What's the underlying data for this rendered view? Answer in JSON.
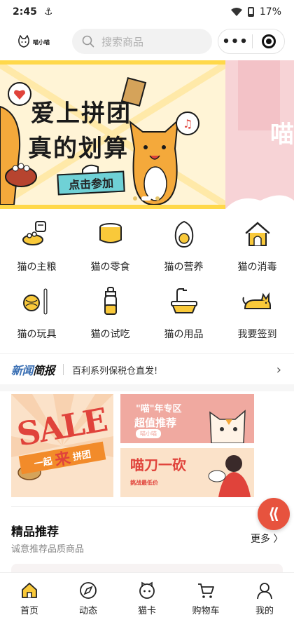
{
  "status_bar": {
    "time": "2:45",
    "battery": "17%"
  },
  "header": {
    "logo_text": "喵小喵",
    "search_placeholder": "搜索商品",
    "more_label": "•••"
  },
  "banner": {
    "slide1_line1": "爱上拼团",
    "slide1_line2": "真的划算",
    "slide1_cta": "点击参加",
    "slide2_partial": "喵"
  },
  "categories": [
    {
      "label": "猫の主粮",
      "icon": "cat-food-bowl-icon"
    },
    {
      "label": "猫の零食",
      "icon": "snack-can-icon"
    },
    {
      "label": "猫の营养",
      "icon": "egg-icon"
    },
    {
      "label": "猫の消毒",
      "icon": "cat-house-icon"
    },
    {
      "label": "猫の玩具",
      "icon": "yarn-ball-bone-icon"
    },
    {
      "label": "猫の试吃",
      "icon": "feeding-bottle-icon"
    },
    {
      "label": "猫の用品",
      "icon": "bathtub-icon"
    },
    {
      "label": "我要签到",
      "icon": "cat-sign-in-icon"
    }
  ],
  "news": {
    "brand_part1": "新闻",
    "brand_part2": "简报",
    "text": "百利系列保税仓直发!"
  },
  "promos": {
    "left_sale": "SALE",
    "left_strip_a": "一起",
    "left_strip_big": "来",
    "left_strip_b": "拼团",
    "right_top_line1": "\"喵\"年专区",
    "right_top_line2": "超值推荐",
    "right_top_pill": "喵小喵",
    "right_bottom_line1": "喵刀一砍",
    "right_bottom_line2": "挑战最低价"
  },
  "recommend": {
    "title": "精品推荐",
    "subtitle": "诚意推荐品质商品",
    "more": "更多 〉"
  },
  "tabs": [
    {
      "label": "首页",
      "icon": "home-icon",
      "active": true
    },
    {
      "label": "动态",
      "icon": "compass-icon"
    },
    {
      "label": "猫卡",
      "icon": "cat-card-icon"
    },
    {
      "label": "购物车",
      "icon": "cart-icon"
    },
    {
      "label": "我的",
      "icon": "profile-icon"
    }
  ],
  "colors": {
    "brand_yellow": "#ffd84a",
    "accent_red": "#e7533e",
    "news_blue": "#3a6fb3"
  }
}
